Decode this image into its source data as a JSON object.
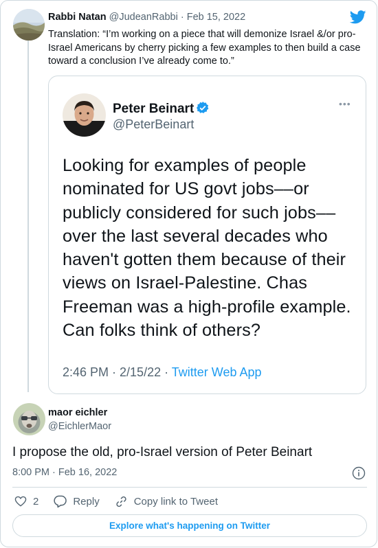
{
  "parent_tweet": {
    "author_name": "Rabbi Natan",
    "handle": "@JudeanRabbi",
    "separator": "·",
    "date": "Feb 15, 2022",
    "text": "Translation: “I’m working on a piece that will demonize Israel &/or pro-Israel Americans by cherry picking a few examples to then build a case toward a conclusion I’ve already come to.”"
  },
  "quoted_tweet": {
    "author_name": "Peter Beinart",
    "handle": "@PeterBeinart",
    "more_label": "•••",
    "text": "Looking for examples of people nominated for US govt  jobs––or publicly considered for such jobs––over the last several decades who haven't gotten them because of their views on Israel-Palestine. Chas Freeman was a high-profile example. Can folks think of others?",
    "timestamp": "2:46 PM · 2/15/22 · ",
    "source": "Twitter Web App"
  },
  "reply_tweet": {
    "author_name": "maor eichler",
    "handle": "@EichlerMaor",
    "text": "I propose the old, pro-Israel version of Peter Beinart",
    "timestamp": "8:00 PM · Feb 16, 2022"
  },
  "actions": {
    "like_count": "2",
    "reply_label": "Reply",
    "copy_link_label": "Copy link to Tweet"
  },
  "footer": {
    "explore_label": "Explore what's happening on Twitter"
  },
  "colors": {
    "accent": "#1d9bf0",
    "text_primary": "#0f1419",
    "text_secondary": "#536471",
    "border": "#cfd9de"
  },
  "icons": {
    "brand": "twitter-bird-icon",
    "verified": "verified-badge-icon",
    "info": "info-icon",
    "like": "heart-icon",
    "reply": "speech-bubble-icon",
    "copy_link": "link-icon"
  }
}
